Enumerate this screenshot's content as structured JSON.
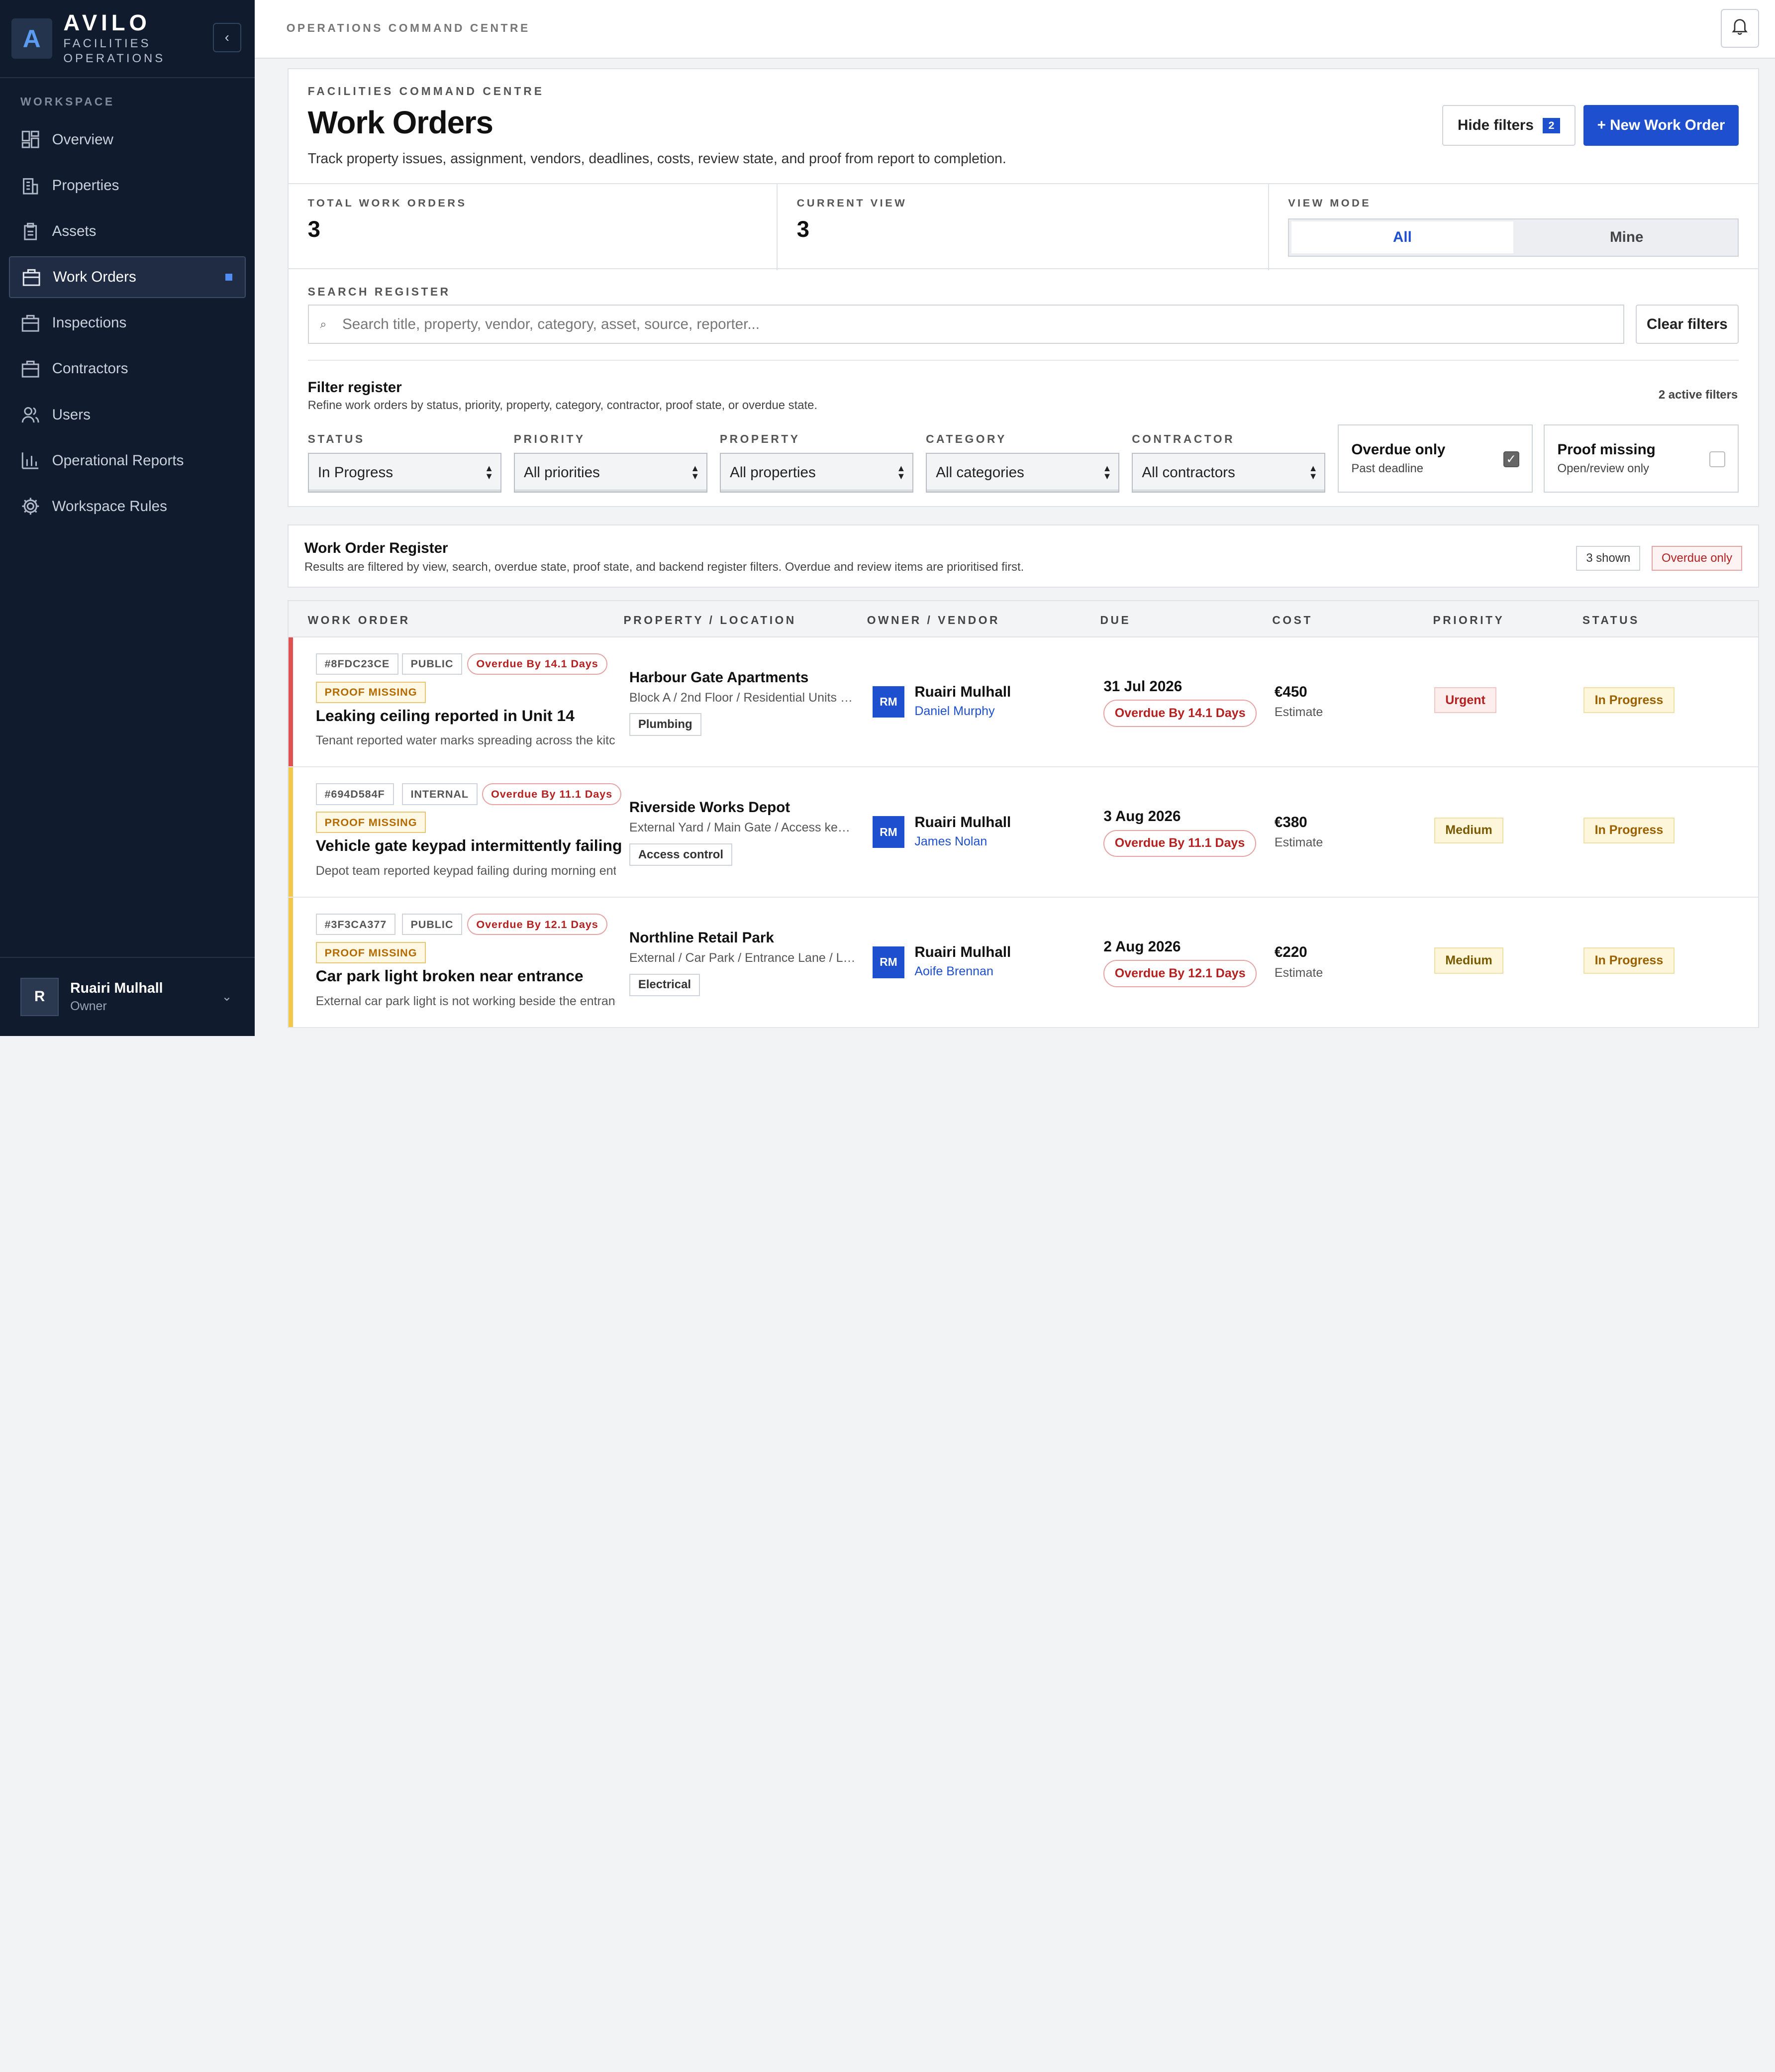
{
  "brand": {
    "name": "AVILO",
    "subtitle": "FACILITIES OPERATIONS",
    "logo_letter": "A",
    "collapse_icon": "chevron-left-icon"
  },
  "sidebar": {
    "section_label": "WORKSPACE",
    "items": [
      {
        "label": "Overview",
        "icon": "grid-icon"
      },
      {
        "label": "Properties",
        "icon": "building-icon"
      },
      {
        "label": "Assets",
        "icon": "clipboard-icon"
      },
      {
        "label": "Work Orders",
        "icon": "briefcase-icon",
        "active": true
      },
      {
        "label": "Inspections",
        "icon": "briefcase-icon"
      },
      {
        "label": "Contractors",
        "icon": "briefcase-icon"
      },
      {
        "label": "Users",
        "icon": "users-icon"
      },
      {
        "label": "Operational Reports",
        "icon": "bar-chart-icon"
      },
      {
        "label": "Workspace Rules",
        "icon": "gear-icon"
      }
    ],
    "user": {
      "initial": "R",
      "name": "Ruairi Mulhall",
      "role": "Owner"
    }
  },
  "topbar": {
    "breadcrumb": "OPERATIONS COMMAND CENTRE",
    "bell_icon": "bell-icon"
  },
  "header": {
    "kicker": "FACILITIES COMMAND CENTRE",
    "title": "Work Orders",
    "description": "Track property issues, assignment, vendors, deadlines, costs, review state, and proof from report to completion.",
    "hide_filters_label": "Hide filters",
    "hide_filters_count": "2",
    "new_work_order_label": "+ New Work Order"
  },
  "stats": {
    "total_label": "TOTAL WORK ORDERS",
    "total_value": "3",
    "current_label": "CURRENT VIEW",
    "current_value": "3",
    "view_mode_label": "VIEW MODE",
    "view_all": "All",
    "view_mine": "Mine"
  },
  "search": {
    "label": "SEARCH REGISTER",
    "placeholder": "Search title, property, vendor, category, asset, source, reporter...",
    "clear_label": "Clear filters"
  },
  "filters": {
    "title": "Filter register",
    "subtitle": "Refine work orders by status, priority, property, category, contractor, proof state, or overdue state.",
    "active_count": "2 active filters",
    "status_label": "STATUS",
    "status_value": "In Progress",
    "priority_label": "PRIORITY",
    "priority_value": "All priorities",
    "property_label": "PROPERTY",
    "property_value": "All properties",
    "category_label": "CATEGORY",
    "category_value": "All categories",
    "contractor_label": "CONTRACTOR",
    "contractor_value": "All contractors",
    "overdue": {
      "title": "Overdue only",
      "sub": "Past deadline",
      "checked": true
    },
    "proof": {
      "title": "Proof missing",
      "sub": "Open/review only",
      "checked": false
    }
  },
  "register": {
    "title": "Work Order Register",
    "subtitle": "Results are filtered by view, search, overdue state, proof state, and backend register filters. Overdue and review items are prioritised first.",
    "shown": "3 shown",
    "overdue_pill": "Overdue only"
  },
  "table": {
    "headers": {
      "work_order": "WORK ORDER",
      "property": "PROPERTY / LOCATION",
      "owner": "OWNER / VENDOR",
      "due": "DUE",
      "cost": "COST",
      "priority": "PRIORITY",
      "status": "STATUS"
    },
    "rows": [
      {
        "id": "#8FDC23CE",
        "visibility": "PUBLIC",
        "overdue": "Overdue By 14.1 Days",
        "proof": "PROOF MISSING",
        "title": "Leaking ceiling reported in Unit 14",
        "desc": "Tenant reported water marks spreading across the kitchen ceiling",
        "property": "Harbour Gate Apartments",
        "location": "Block A / 2nd Floor / Residential Units / ...",
        "category": "Plumbing",
        "owner_initials": "RM",
        "owner": "Ruairi Mulhall",
        "vendor": "Daniel Murphy",
        "due_date": "31 Jul 2026",
        "due_badge": "Overdue By 14.1 Days",
        "cost": "€450",
        "cost_label": "Estimate",
        "priority": "Urgent",
        "status": "In Progress",
        "accent": "#e05252"
      },
      {
        "id": "#694D584F",
        "visibility": "INTERNAL",
        "overdue": "Overdue By 11.1 Days",
        "proof": "PROOF MISSING",
        "title": "Vehicle gate keypad intermittently failing",
        "desc": "Depot team reported keypad failing during morning entry",
        "property": "Riverside Works Depot",
        "location": "External Yard / Main Gate / Access keypad",
        "category": "Access control",
        "owner_initials": "RM",
        "owner": "Ruairi Mulhall",
        "vendor": "James Nolan",
        "due_date": "3 Aug 2026",
        "due_badge": "Overdue By 11.1 Days",
        "cost": "€380",
        "cost_label": "Estimate",
        "priority": "Medium",
        "status": "In Progress",
        "accent": "#f1c84b"
      },
      {
        "id": "#3F3CA377",
        "visibility": "PUBLIC",
        "overdue": "Overdue By 12.1 Days",
        "proof": "PROOF MISSING",
        "title": "Car park light broken near entrance",
        "desc": "External car park light is not working beside the entrance",
        "property": "Northline Retail Park",
        "location": "External / Car Park / Entrance Lane / Lighting",
        "category": "Electrical",
        "owner_initials": "RM",
        "owner": "Ruairi Mulhall",
        "vendor": "Aoife Brennan",
        "due_date": "2 Aug 2026",
        "due_badge": "Overdue By 12.1 Days",
        "cost": "€220",
        "cost_label": "Estimate",
        "priority": "Medium",
        "status": "In Progress",
        "accent": "#f1c84b"
      }
    ]
  }
}
